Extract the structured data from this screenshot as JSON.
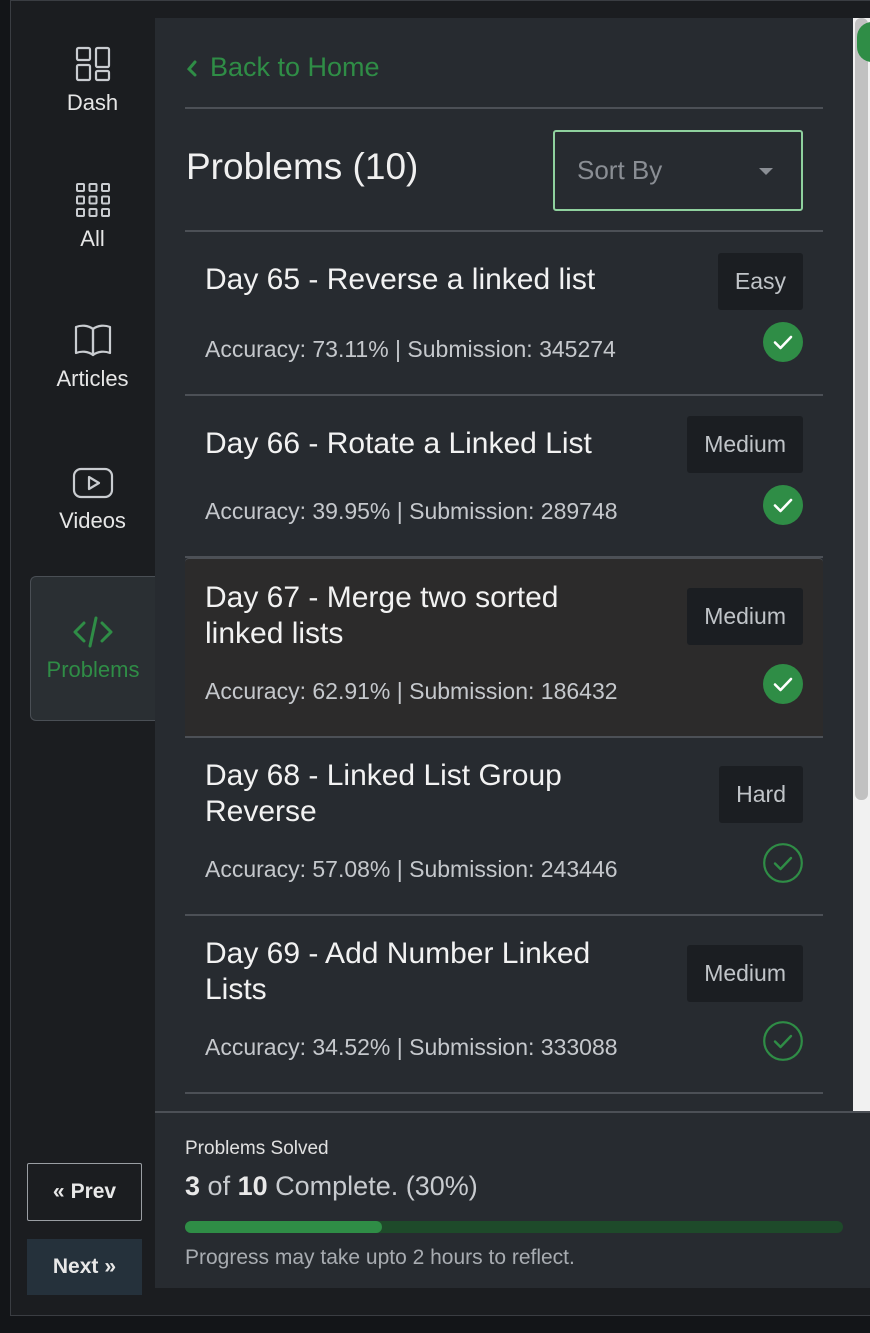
{
  "sidebar": {
    "items": [
      {
        "label": "Dash",
        "icon": "dashboard-icon"
      },
      {
        "label": "All",
        "icon": "grid-icon"
      },
      {
        "label": "Articles",
        "icon": "book-icon"
      },
      {
        "label": "Videos",
        "icon": "video-icon"
      },
      {
        "label": "Problems",
        "icon": "code-icon",
        "active": true
      }
    ],
    "prev_label": "Prev",
    "next_label": "Next"
  },
  "header": {
    "back_label": "Back to Home",
    "title": "Problems (10)",
    "sort_placeholder": "Sort By"
  },
  "problems": [
    {
      "title": "Day 65 - Reverse a linked list",
      "difficulty": "Easy",
      "meta": "Accuracy: 73.11% | Submission: 345274",
      "solved": true
    },
    {
      "title": "Day 66 - Rotate a Linked List",
      "difficulty": "Medium",
      "meta": "Accuracy: 39.95% | Submission: 289748",
      "solved": true
    },
    {
      "title": "Day 67 - Merge two sorted linked lists",
      "difficulty": "Medium",
      "meta": "Accuracy: 62.91% | Submission: 186432",
      "solved": true
    },
    {
      "title": "Day 68 - Linked List Group Reverse",
      "difficulty": "Hard",
      "meta": "Accuracy: 57.08% | Submission: 243446",
      "solved": false
    },
    {
      "title": "Day 69 - Add Number Linked Lists",
      "difficulty": "Medium",
      "meta": "Accuracy: 34.52% | Submission: 333088",
      "solved": false
    }
  ],
  "stats": {
    "label": "Problems Solved",
    "solved": "3",
    "of_text": "of",
    "total": "10",
    "complete_text": "Complete. (30%)",
    "progress": 0.3,
    "note": "Progress may take upto 2 hours to reflect."
  },
  "colors": {
    "accent": "#2f8d46",
    "panel": "#272b30",
    "sidebar": "#1b1d20"
  }
}
